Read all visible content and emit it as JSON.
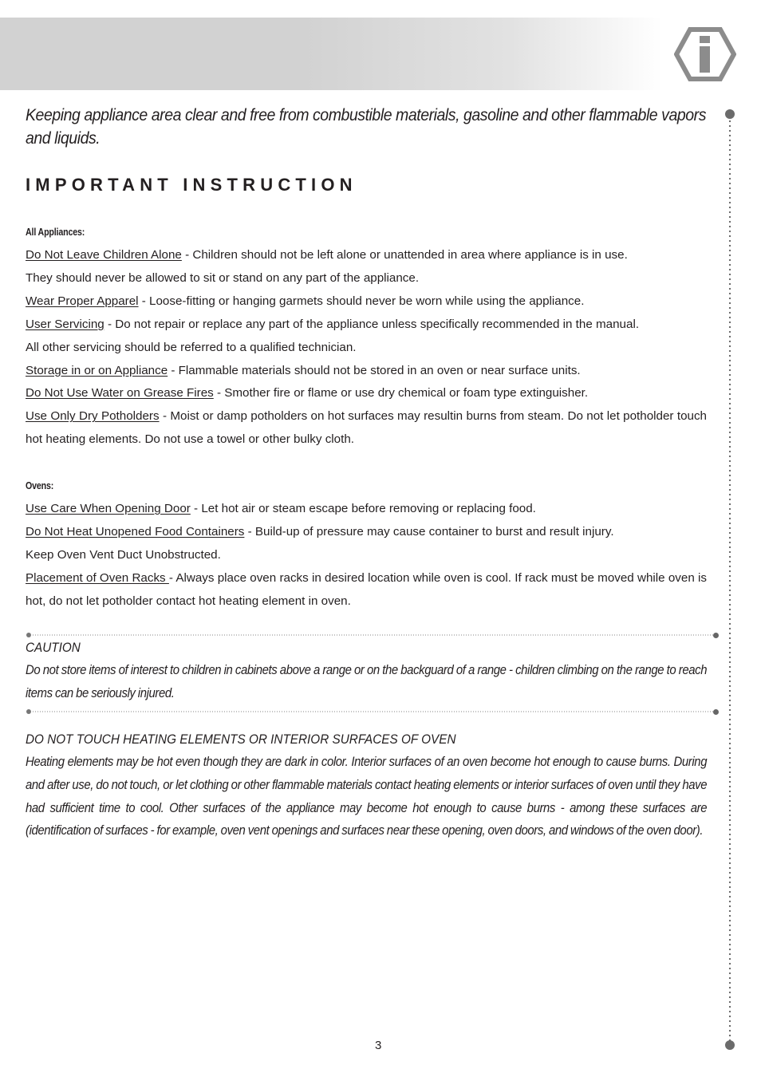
{
  "header": {
    "icon": "info-hexagon-icon",
    "band_color": "#d2d2d2",
    "icon_color": "#8c8c8c"
  },
  "intro": "Keeping appliance area clear and free from combustible materials, gasoline and other flammable vapors and liquids.",
  "section_title": "IMPORTANT INSTRUCTION",
  "all_appliances": {
    "heading": "All Appliances:",
    "items": [
      {
        "title": "Do Not Leave Children Alone",
        "text": " - Children should not be left alone or unattended in area where appliance is in use.",
        "continuation": "They should never be allowed to sit or stand on any part of the appliance."
      },
      {
        "title": "Wear Proper Apparel",
        "text": " - Loose-fitting or hanging garmets should never be worn while using the appliance."
      },
      {
        "title": "User Servicing",
        "text": " - Do not repair or replace any part of the appliance unless specifically recommended in the manual.",
        "continuation": "All other servicing should be referred to a qualified technician."
      },
      {
        "title": "Storage in or on Appliance",
        "text": " - Flammable materials should not be stored in an oven or near surface units."
      },
      {
        "title": "Do Not Use Water on Grease Fires",
        "text": " - Smother fire or flame or use dry chemical or foam type extinguisher."
      },
      {
        "title": "Use Only Dry Potholders",
        "text": " - Moist or damp potholders on hot surfaces may resultin burns from steam. Do not let potholder touch hot heating elements. Do not use a towel or other bulky cloth."
      }
    ]
  },
  "ovens": {
    "heading": "Ovens:",
    "items": [
      {
        "title": "Use Care When Opening Door",
        "text": " - Let hot air or steam escape before removing or replacing food."
      },
      {
        "title": "Do Not Heat Unopened Food Containers",
        "text": " - Build-up of pressure may cause container to burst and result injury."
      },
      {
        "plain": "Keep Oven Vent Duct Unobstructed."
      },
      {
        "title": "Placement of Oven Racks ",
        "text": "- Always place oven racks in desired location while oven is cool. If rack must be moved while oven is hot, do not let potholder contact hot heating element in oven."
      }
    ]
  },
  "caution": {
    "title": "CAUTION",
    "text": "Do not store items of interest to children in cabinets above a range or on the backguard of a range - children climbing on the range to reach items can be seriously injured."
  },
  "warning": {
    "title": "DO NOT TOUCH HEATING ELEMENTS OR INTERIOR SURFACES OF OVEN",
    "text": "Heating elements may be hot even though they are dark in color. Interior surfaces of an oven become hot enough to cause burns. During and after use, do not touch, or let clothing or other flammable materials contact heating elements or interior surfaces of oven until they have had sufficient time to cool. Other surfaces of the appliance may become hot enough to cause burns - among these surfaces are (identification of surfaces - for example, oven vent openings and surfaces near these opening, oven doors, and windows of the oven door)."
  },
  "page_number": "3"
}
